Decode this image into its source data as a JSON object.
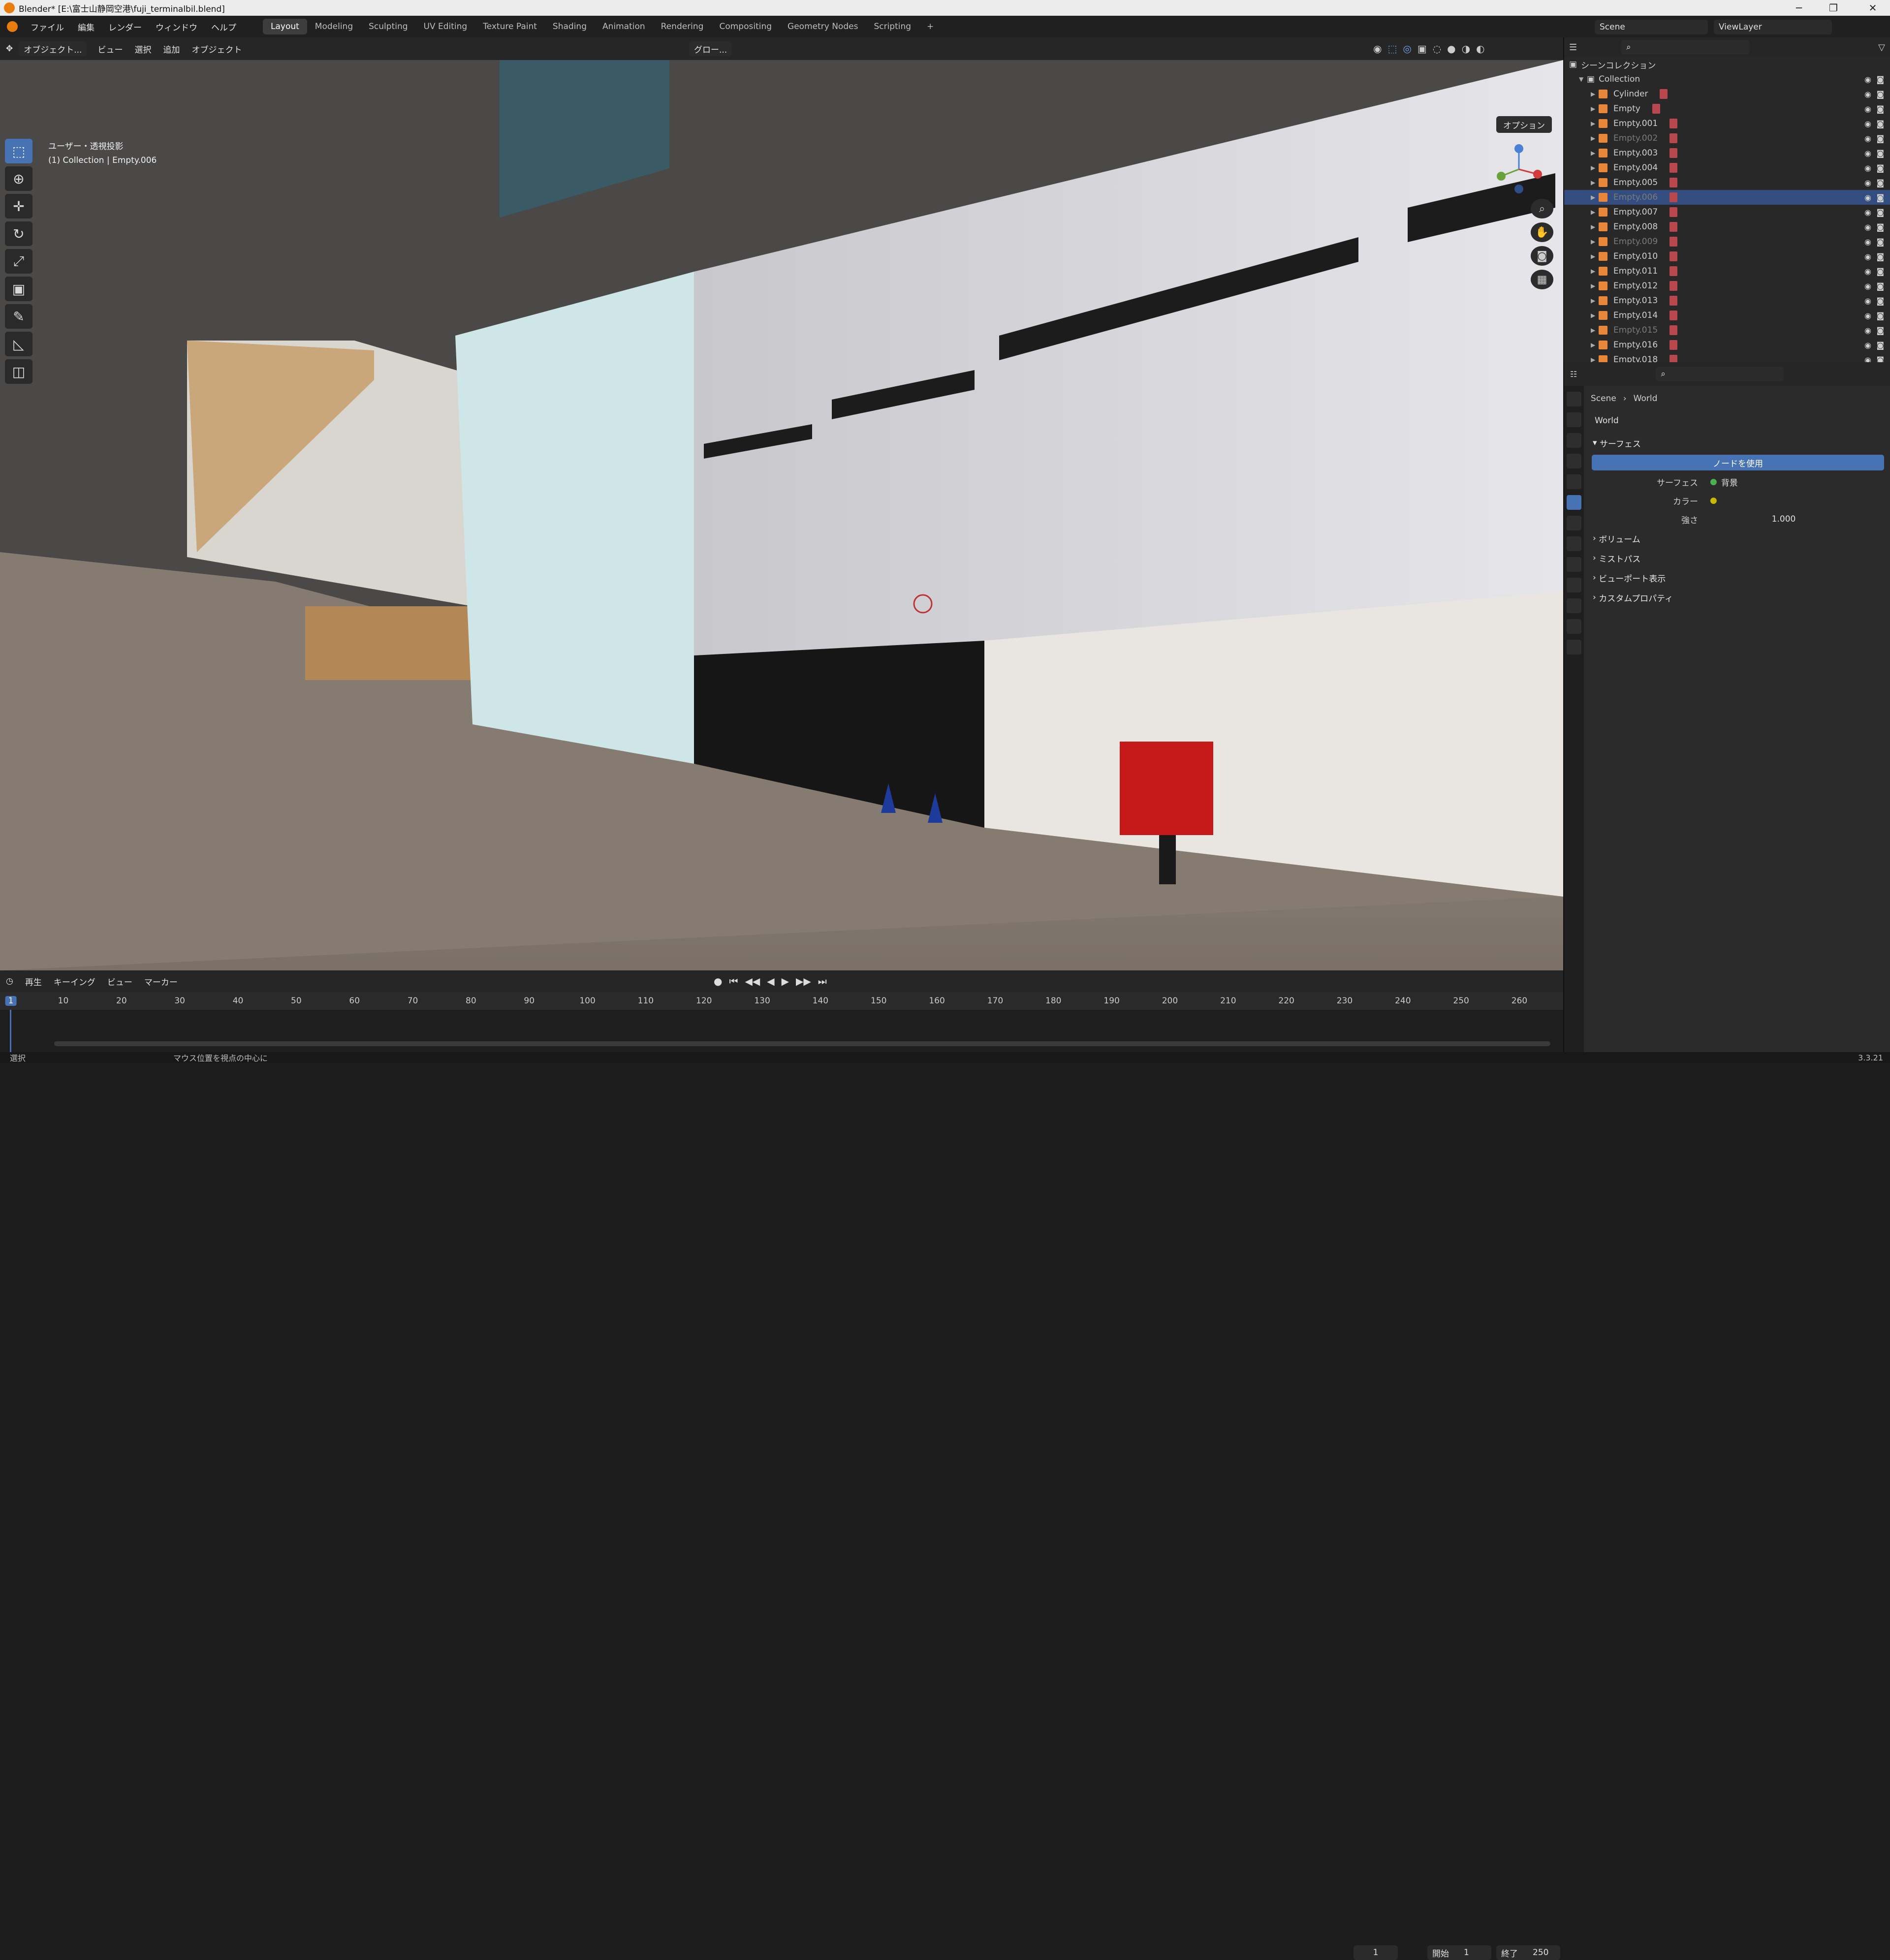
{
  "titlebar": {
    "title": "Blender* [E:\\富士山静岡空港\\fuji_terminalbil.blend]",
    "min": "─",
    "max": "❐",
    "close": "✕"
  },
  "menu": {
    "items": [
      "ファイル",
      "編集",
      "レンダー",
      "ウィンドウ",
      "ヘルプ"
    ],
    "workspaces": [
      "Layout",
      "Modeling",
      "Sculpting",
      "UV Editing",
      "Texture Paint",
      "Shading",
      "Animation",
      "Rendering",
      "Compositing",
      "Geometry Nodes",
      "Scripting"
    ],
    "active_workspace": "Layout",
    "add": "+"
  },
  "scene": {
    "name": "Scene",
    "viewlayer": "ViewLayer"
  },
  "viewport_header": {
    "mode": "オブジェクト...",
    "items": [
      "ビュー",
      "選択",
      "追加",
      "オブジェクト"
    ],
    "transform": "グロー...",
    "options": "オプション"
  },
  "viewport_info": {
    "line1": "ユーザー・透視投影",
    "line2": "(1) Collection | Empty.006"
  },
  "timeline": {
    "menu": [
      "再生",
      "キーイング",
      "ビュー",
      "マーカー"
    ],
    "current_frame": "1",
    "start_label": "開始",
    "start": "1",
    "end_label": "終了",
    "end": "250",
    "ticks": [
      "1",
      "10",
      "20",
      "30",
      "40",
      "50",
      "60",
      "70",
      "80",
      "90",
      "100",
      "110",
      "120",
      "130",
      "140",
      "150",
      "160",
      "170",
      "180",
      "190",
      "200",
      "210",
      "220",
      "230",
      "240",
      "250",
      "260"
    ]
  },
  "statusbar": {
    "left": "選択",
    "middle": "マウス位置を視点の中心に",
    "version": "3.3.21"
  },
  "outliner": {
    "root": "シーンコレクション",
    "collection": "Collection",
    "items": [
      {
        "name": "Cylinder",
        "dim": false,
        "sel": false
      },
      {
        "name": "Empty",
        "dim": false,
        "sel": false
      },
      {
        "name": "Empty.001",
        "dim": false,
        "sel": false
      },
      {
        "name": "Empty.002",
        "dim": true,
        "sel": false
      },
      {
        "name": "Empty.003",
        "dim": false,
        "sel": false
      },
      {
        "name": "Empty.004",
        "dim": false,
        "sel": false
      },
      {
        "name": "Empty.005",
        "dim": false,
        "sel": false
      },
      {
        "name": "Empty.006",
        "dim": true,
        "sel": true
      },
      {
        "name": "Empty.007",
        "dim": false,
        "sel": false
      },
      {
        "name": "Empty.008",
        "dim": false,
        "sel": false
      },
      {
        "name": "Empty.009",
        "dim": true,
        "sel": false
      },
      {
        "name": "Empty.010",
        "dim": false,
        "sel": false
      },
      {
        "name": "Empty.011",
        "dim": false,
        "sel": false
      },
      {
        "name": "Empty.012",
        "dim": false,
        "sel": false
      },
      {
        "name": "Empty.013",
        "dim": false,
        "sel": false
      },
      {
        "name": "Empty.014",
        "dim": false,
        "sel": false
      },
      {
        "name": "Empty.015",
        "dim": true,
        "sel": false
      },
      {
        "name": "Empty.016",
        "dim": false,
        "sel": false
      },
      {
        "name": "Empty.018",
        "dim": false,
        "sel": false
      }
    ]
  },
  "properties": {
    "breadcrumb_scene": "Scene",
    "breadcrumb_world": "World",
    "world_name": "World",
    "surface_section": "サーフェス",
    "use_nodes": "ノードを使用",
    "surface_label": "サーフェス",
    "surface_value": "背景",
    "color_label": "カラー",
    "strength_label": "強さ",
    "strength_value": "1.000",
    "sections": [
      "ボリューム",
      "ミストパス",
      "ビューポート表示",
      "カスタムプロパティ"
    ]
  },
  "colors": {
    "accent": "#4772b3",
    "selected_row": "#334d80",
    "mailbox": "#c61a1a",
    "blender_orange": "#e87d0d"
  }
}
